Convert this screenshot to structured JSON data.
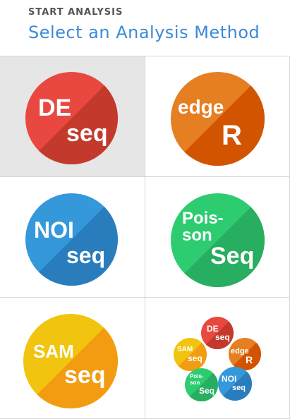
{
  "header": {
    "eyebrow": "START ANALYSIS",
    "title": "Select an Analysis Method"
  },
  "methods": [
    {
      "id": "deseq",
      "line1": "DE",
      "line2": "seq",
      "color": "#e8483f",
      "shade": "#c33a2d",
      "selected": true
    },
    {
      "id": "edger",
      "line1": "edge",
      "line2": "R",
      "color": "#e67e22",
      "shade": "#d35400",
      "selected": false
    },
    {
      "id": "noiseq",
      "line1": "NOI",
      "line2": "seq",
      "color": "#3498db",
      "shade": "#2a7dbd",
      "selected": false
    },
    {
      "id": "poissonseq",
      "line1": "Pois-",
      "line1b": "son",
      "line2": "Seq",
      "color": "#2ecc71",
      "shade": "#27ae60",
      "selected": false
    },
    {
      "id": "samseq",
      "line1": "SAM",
      "line2": "seq",
      "color": "#f1c40f",
      "shade": "#f39c12",
      "selected": false
    }
  ],
  "all_methods": {
    "deseq": {
      "line1": "DE",
      "line2": "seq"
    },
    "edger": {
      "line1": "edge",
      "line2": "R"
    },
    "samseq": {
      "line1": "SAM",
      "line2": "seq"
    },
    "poissonseq": {
      "line1": "Pois-",
      "line1b": "son",
      "line2": "Seq"
    },
    "noiseq": {
      "line1": "NOI",
      "line2": "seq"
    }
  }
}
